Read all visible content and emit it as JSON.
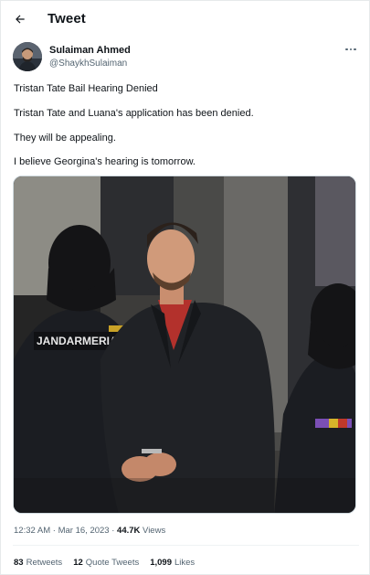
{
  "header": {
    "title": "Tweet",
    "back_icon": "arrow-left-icon"
  },
  "author": {
    "name": "Sulaiman Ahmed",
    "handle": "@ShaykhSulaiman",
    "more_icon": "more-horizontal-icon"
  },
  "tweet": {
    "lines": [
      "Tristan Tate Bail Hearing Denied",
      "Tristan Tate and Luana's application has been denied.",
      "They will be appealing.",
      "I believe Georgina's hearing is tomorrow."
    ],
    "photo": {
      "vest_text": "JANDARMERIA"
    }
  },
  "meta": {
    "time": "12:32 AM",
    "separator": "·",
    "date": "Mar 16, 2023",
    "views_count": "44.7K",
    "views_label": "Views"
  },
  "stats": {
    "retweets": {
      "count": "83",
      "label": "Retweets"
    },
    "quotes": {
      "count": "12",
      "label": "Quote Tweets"
    },
    "likes": {
      "count": "1,099",
      "label": "Likes"
    }
  },
  "colors": {
    "text": "#0f1419",
    "secondary_text": "#536471",
    "border": "#cfd9de",
    "accent_shirt": "#b3312c"
  }
}
